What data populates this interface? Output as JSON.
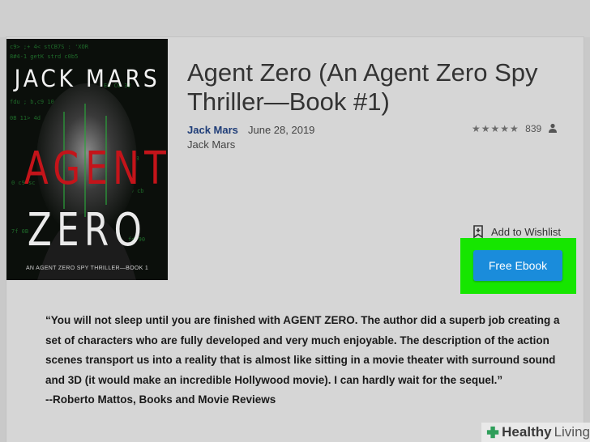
{
  "book": {
    "title": "Agent Zero (An Agent Zero Spy Thriller—Book #1)",
    "author_link": "Jack Mars",
    "date": "June 28, 2019",
    "author_name": "Jack Mars",
    "rating_stars": "★★★★★",
    "rating_count": "839",
    "icons": {
      "rating": "person-icon",
      "wishlist": "bookmark-plus-icon"
    }
  },
  "cover": {
    "author": "JACK MARS",
    "title_line1": "AGENT",
    "title_line2": "ZERO",
    "series": "AN AGENT ZERO SPY THRILLER—BOOK 1"
  },
  "actions": {
    "wishlist_label": "Add to Wishlist",
    "free_ebook_label": "Free Ebook"
  },
  "review": {
    "quote": "“You will not sleep until you are finished with AGENT ZERO. The author did a superb job creating a set of characters who are fully developed and very much enjoyable. The description of the action scenes transport us into a reality that is almost like sitting in a movie theater with surround sound and 3D (it would make an incredible Hollywood movie). I can hardly wait for the sequel.”",
    "attribution": "--Roberto Mattos, Books and Movie Reviews"
  },
  "watermark": {
    "word1": "Healthy",
    "word2": "Living",
    "icon": "plus-icon"
  },
  "colors": {
    "highlight": "#16e600",
    "button": "#1a8cdb",
    "title_red": "#c4141a",
    "link": "#1f3d78"
  }
}
